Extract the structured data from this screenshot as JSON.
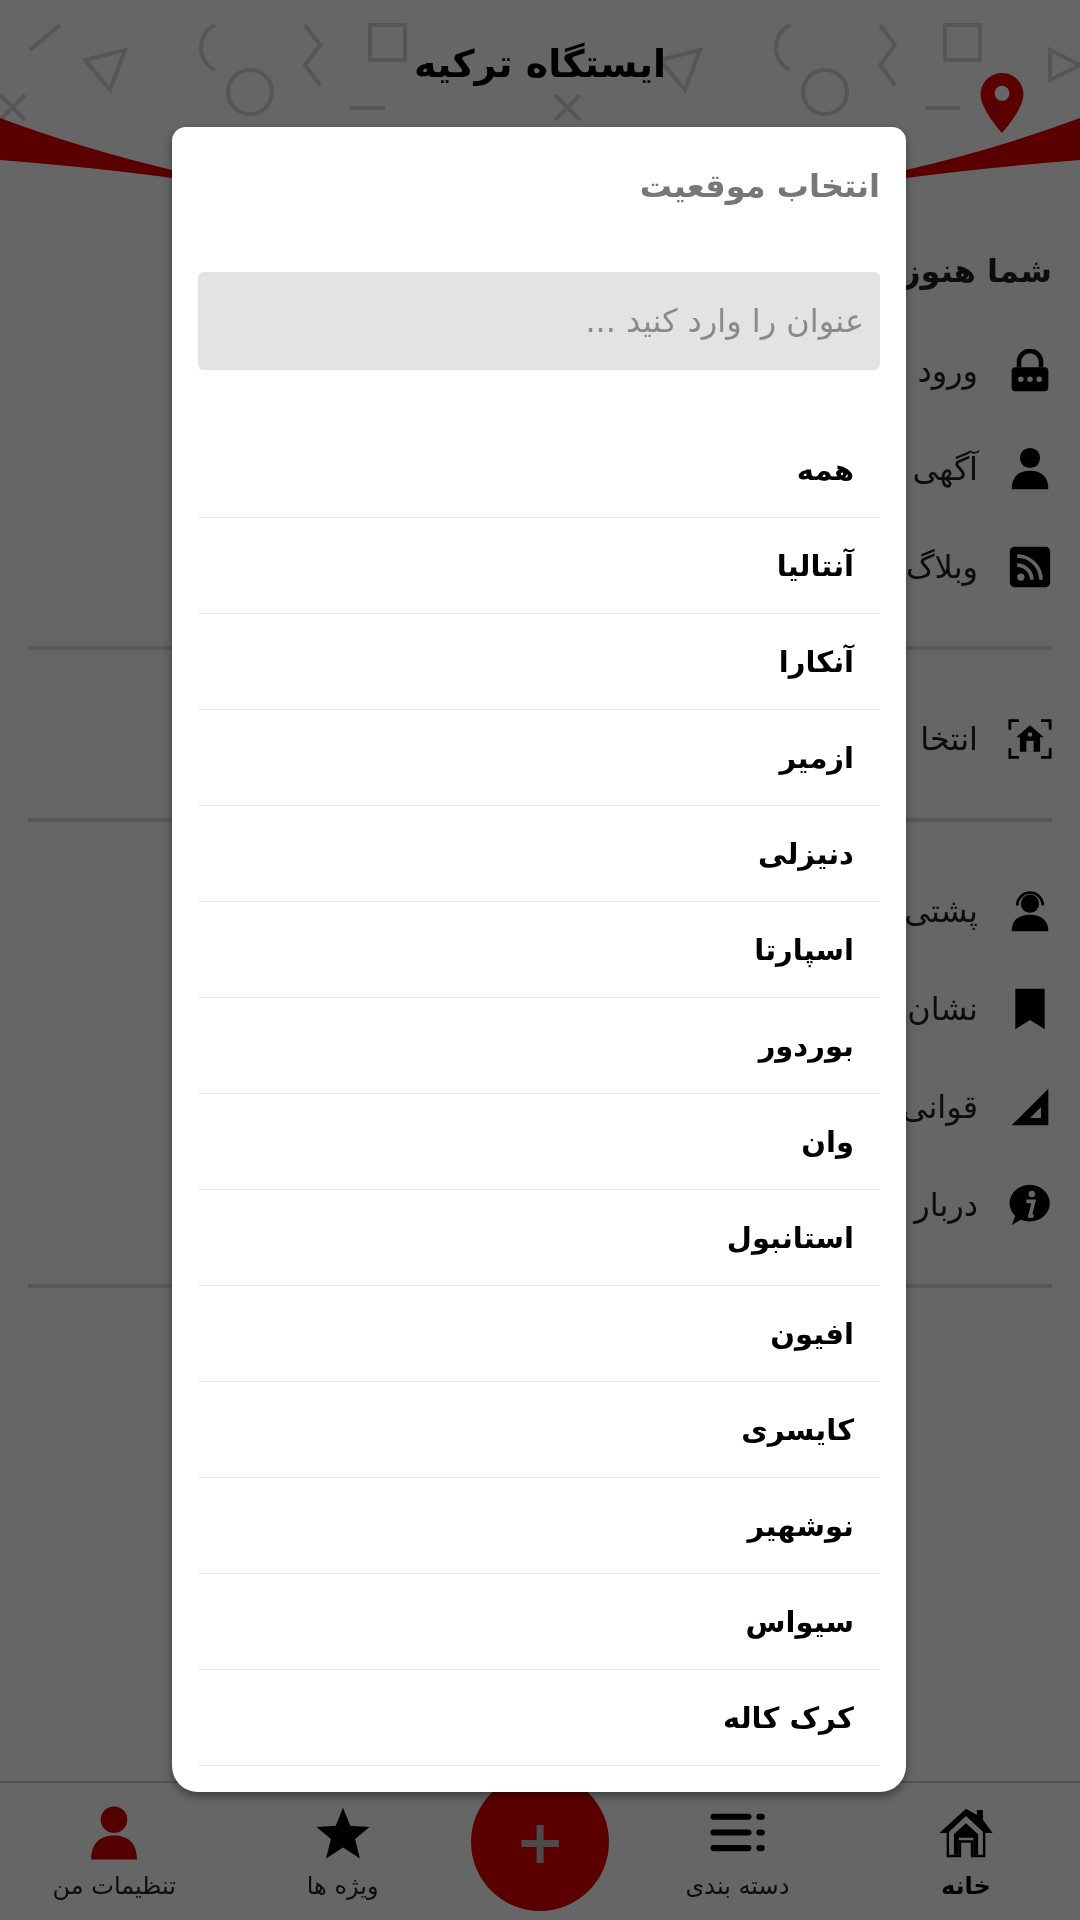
{
  "header": {
    "title": "ایستگاه ترکیه"
  },
  "menu": {
    "notice": "شما هنوز",
    "sections": [
      {
        "items": [
          {
            "label": "ورود"
          },
          {
            "label": "آگهی"
          },
          {
            "label": "وبلاگ"
          }
        ]
      },
      {
        "items": [
          {
            "label": "انتخا"
          }
        ]
      },
      {
        "items": [
          {
            "label": "پشتی"
          },
          {
            "label": "نشان"
          },
          {
            "label": "قوانی"
          },
          {
            "label": "دربار"
          }
        ]
      }
    ]
  },
  "dialog": {
    "title": "انتخاب موقعیت",
    "search": {
      "placeholder": "عنوان را وارد کنید ..."
    },
    "options": [
      "همه",
      "آنتالیا",
      "آنکارا",
      "ازمیر",
      "دنیزلی",
      "اسپارتا",
      "بوردور",
      "وان",
      "استانبول",
      "افیون",
      "کایسری",
      "نوشهیر",
      "سیواس",
      "کرک کاله"
    ]
  },
  "bottom_nav": {
    "items": [
      {
        "label": "خانه",
        "selected": true
      },
      {
        "label": "دسته بندی",
        "selected": false
      },
      {
        "label": "ویژه ها",
        "selected": false
      },
      {
        "label": "تنظیمات من",
        "selected": false
      }
    ],
    "add_button": "+"
  }
}
